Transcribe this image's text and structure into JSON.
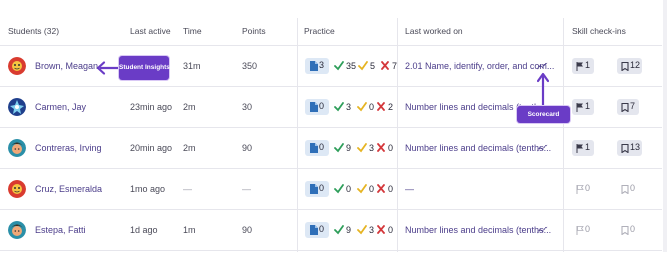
{
  "headers": {
    "students": "Students (32)",
    "last_active": "Last active",
    "time": "Time",
    "points": "Points",
    "practice": "Practice",
    "last_worked_on": "Last worked on",
    "skill_checkins": "Skill check-ins"
  },
  "rows": [
    {
      "name": "Brown, Meagan",
      "last_active": "",
      "time": "31m",
      "points": "350",
      "assigned": "3",
      "correct": "35",
      "partial": "5",
      "wrong": "7",
      "last_worked": "2.01 Name, identify, order, and com...",
      "flags": "1",
      "badges": "12",
      "skills_active": true
    },
    {
      "name": "Carmen, Jay",
      "last_active": "23min ago",
      "time": "2m",
      "points": "30",
      "assigned": "0",
      "correct": "3",
      "partial": "0",
      "wrong": "2",
      "last_worked": "Number lines and decimals (tenth...",
      "flags": "1",
      "badges": "7",
      "skills_active": true
    },
    {
      "name": "Contreras, Irving",
      "last_active": "20min ago",
      "time": "2m",
      "points": "90",
      "assigned": "0",
      "correct": "9",
      "partial": "3",
      "wrong": "0",
      "last_worked": "Number lines and decimals (tenths...",
      "flags": "1",
      "badges": "13",
      "skills_active": true
    },
    {
      "name": "Cruz, Esmeralda",
      "last_active": "1mo ago",
      "time": "—",
      "points": "—",
      "assigned": "0",
      "correct": "0",
      "partial": "0",
      "wrong": "0",
      "last_worked": "—",
      "flags": "0",
      "badges": "0",
      "skills_active": false
    },
    {
      "name": "Estepa, Fatti",
      "last_active": "1d ago",
      "time": "1m",
      "points": "90",
      "assigned": "0",
      "correct": "9",
      "partial": "3",
      "wrong": "0",
      "last_worked": "Number lines and decimals (tenths...",
      "flags": "0",
      "badges": "0",
      "skills_active": false
    }
  ],
  "annotations": {
    "student_insights": "Student Insights",
    "scorecard": "Scorecard"
  },
  "colors": {
    "accent": "#6a3cc6",
    "link": "#4b3d8a",
    "chip_bg": "#dde8f5",
    "correct": "#2e9e5a",
    "partial": "#e6b422",
    "wrong": "#d4373b"
  }
}
